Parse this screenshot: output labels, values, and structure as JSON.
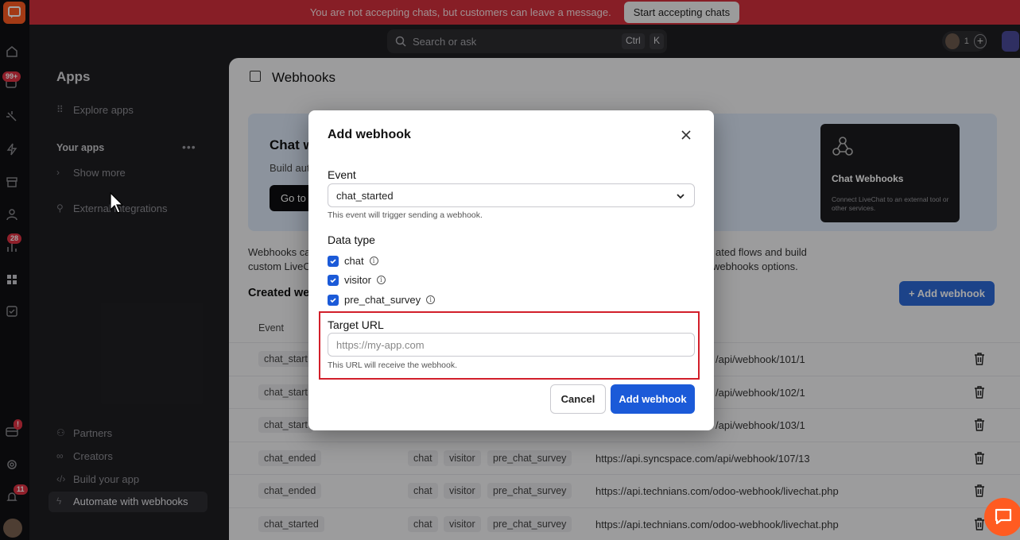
{
  "banner": {
    "message": "You are not accepting chats, but customers can leave a message.",
    "button": "Start accepting chats"
  },
  "rail": {
    "badges": {
      "chats": "99+",
      "reports": "28",
      "billing": "!",
      "notifications": "11"
    }
  },
  "topbar": {
    "search_placeholder": "Search or ask",
    "kbd_ctrl": "Ctrl",
    "kbd_k": "K",
    "agent_count": "1"
  },
  "sidebar": {
    "title": "Apps",
    "explore": "Explore apps",
    "your_apps": "Your apps",
    "show_more": "Show more",
    "external": "External integrations",
    "partners": "Partners",
    "creators": "Creators",
    "build": "Build your app",
    "automate": "Automate with webhooks"
  },
  "main": {
    "title": "Webhooks",
    "hero_title": "Chat w",
    "hero_sub": "Build aut",
    "hero_btn": "Go to",
    "hero_card_title": "Chat Webhooks",
    "hero_card_sub": "Connect LiveChat to an external tool or other services.",
    "desc_left_1": "Webhooks ca",
    "desc_left_2": "custom LiveC",
    "desc_right_1": "ated flows and build",
    "desc_right_2": "webhooks options.",
    "created": "Created we",
    "add_button": "Add webhook",
    "col_event": "Event",
    "rows": [
      {
        "event": "chat_start",
        "tags": [],
        "url": "/api/webhook/101/1"
      },
      {
        "event": "chat_start",
        "tags": [],
        "url": "/api/webhook/102/1"
      },
      {
        "event": "chat_start",
        "tags": [],
        "url": "/api/webhook/103/1"
      },
      {
        "event": "chat_ended",
        "tags": [
          "chat",
          "visitor",
          "pre_chat_survey"
        ],
        "url": "https://api.syncspace.com/api/webhook/107/13"
      },
      {
        "event": "chat_ended",
        "tags": [
          "chat",
          "visitor",
          "pre_chat_survey"
        ],
        "url": "https://api.technians.com/odoo-webhook/livechat.php"
      },
      {
        "event": "chat_started",
        "tags": [
          "chat",
          "visitor",
          "pre_chat_survey"
        ],
        "url": "https://api.technians.com/odoo-webhook/livechat.php"
      }
    ]
  },
  "modal": {
    "title": "Add webhook",
    "event_label": "Event",
    "event_value": "chat_started",
    "event_hint": "This event will trigger sending a webhook.",
    "datatype_label": "Data type",
    "datatypes": [
      "chat",
      "visitor",
      "pre_chat_survey"
    ],
    "target_label": "Target URL",
    "target_placeholder": "https://my-app.com",
    "target_hint": "This URL will receive the webhook.",
    "cancel": "Cancel",
    "submit": "Add webhook"
  },
  "colors": {
    "banner": "#d32f3c",
    "primary": "#1b5ad8",
    "highlight": "#d21f2a",
    "brand": "#ff5b21"
  }
}
